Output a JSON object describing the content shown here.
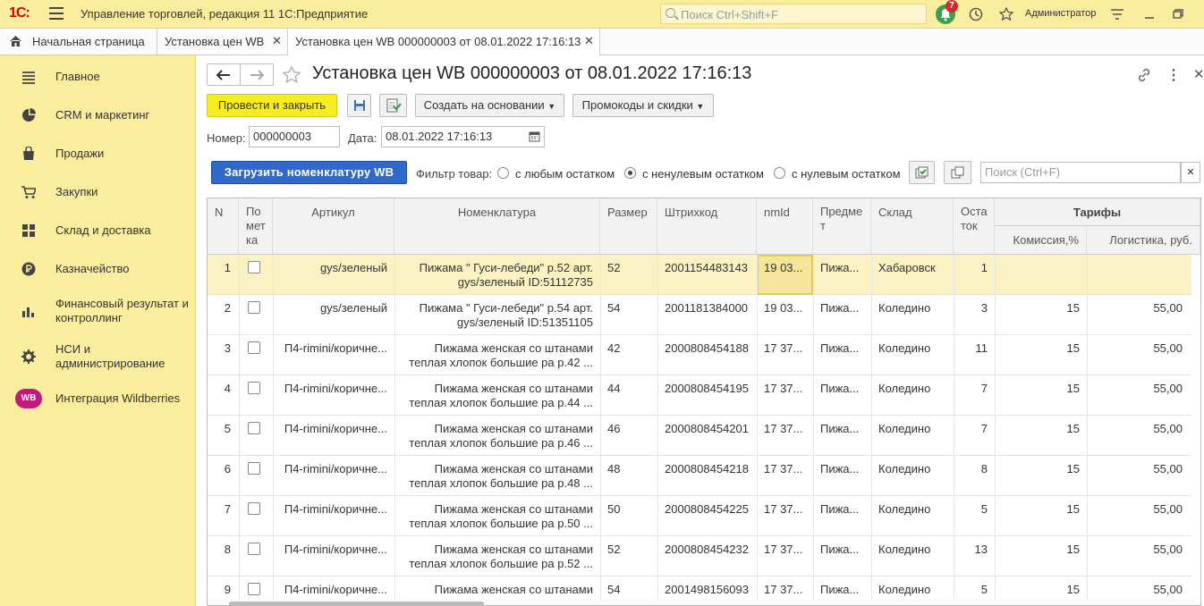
{
  "app": {
    "logo": "1С:",
    "title": "Управление торговлей, редакция 11 1С:Предприятие",
    "search_placeholder": "Поиск Ctrl+Shift+F",
    "notifications_count": "7",
    "user": "Администратор"
  },
  "tabs": [
    {
      "label": "Начальная страница"
    },
    {
      "label": "Установка цен WB"
    },
    {
      "label": "Установка цен WB 000000003 от 08.01.2022 17:16:13"
    }
  ],
  "sidebar": {
    "items": [
      {
        "label": "Главное",
        "icon": "menu-icon"
      },
      {
        "label": "CRM и маркетинг",
        "icon": "pie-chart-icon"
      },
      {
        "label": "Продажи",
        "icon": "bag-icon"
      },
      {
        "label": "Закупки",
        "icon": "cart-icon"
      },
      {
        "label": "Склад и доставка",
        "icon": "grid-icon"
      },
      {
        "label": "Казначейство",
        "icon": "ruble-icon"
      },
      {
        "label": "Финансовый результат и контроллинг",
        "icon": "bar-chart-icon"
      },
      {
        "label": "НСИ и администрирование",
        "icon": "gear-icon"
      },
      {
        "label": "Интеграция Wildberries",
        "icon": "wb-icon",
        "icon_text": "WB"
      }
    ]
  },
  "document": {
    "title": "Установка цен WB 000000003 от 08.01.2022 17:16:13",
    "post_close": "Провести и закрыть",
    "create_based": "Создать на основании",
    "promo": "Промокоды и скидки",
    "number_label": "Номер:",
    "number_value": "000000003",
    "date_label": "Дата:",
    "date_value": "08.01.2022 17:16:13",
    "load_button": "Загрузить  номенклатуру WB",
    "filter_label": "Фильтр товар:",
    "filter_any": "с любым остатком",
    "filter_nonzero": "с ненулевым остатком",
    "filter_zero": "с нулевым остатком",
    "filter_selected": "nonzero",
    "table_search_placeholder": "Поиск (Ctrl+F)"
  },
  "table": {
    "headers": {
      "n": "N",
      "mark": "По\nмет\nка",
      "article": "Артикул",
      "nomenclature": "Номенклатура",
      "size": "Размер",
      "barcode": "Штрихкод",
      "nmid": "nmId",
      "subject": "Предме\nт",
      "warehouse": "Склад",
      "stock": "Оста\nток",
      "tariffs": "Тарифы",
      "commission": "Комиссия,%",
      "logistics": "Логистика, руб."
    },
    "rows": [
      {
        "n": "1",
        "article": "gys/зеленый",
        "nom1": "Пижама \" Гуси-лебеди\" р.52 арт.",
        "nom2": "gys/зеленый ID:51112735",
        "size": "52",
        "barcode": "2001154483143",
        "nmid": "19 03...",
        "subject": "Пижа...",
        "warehouse": "Хабаровск",
        "stock": "1",
        "commission": "",
        "logistics": ""
      },
      {
        "n": "2",
        "article": "gys/зеленый",
        "nom1": "Пижама \" Гуси-лебеди\" р.54 арт.",
        "nom2": "gys/зеленый ID:51351105",
        "size": "54",
        "barcode": "2001181384000",
        "nmid": "19 03...",
        "subject": "Пижа...",
        "warehouse": "Коледино",
        "stock": "3",
        "commission": "15",
        "logistics": "55,00"
      },
      {
        "n": "3",
        "article": "П4-rimini/коричне...",
        "nom1": "Пижама женская со штанами",
        "nom2": "теплая хлопок большие ра р.42 ...",
        "size": "42",
        "barcode": "2000808454188",
        "nmid": "17 37...",
        "subject": "Пижа...",
        "warehouse": "Коледино",
        "stock": "11",
        "commission": "15",
        "logistics": "55,00"
      },
      {
        "n": "4",
        "article": "П4-rimini/коричне...",
        "nom1": "Пижама женская со штанами",
        "nom2": "теплая хлопок большие ра р.44 ...",
        "size": "44",
        "barcode": "2000808454195",
        "nmid": "17 37...",
        "subject": "Пижа...",
        "warehouse": "Коледино",
        "stock": "7",
        "commission": "15",
        "logistics": "55,00"
      },
      {
        "n": "5",
        "article": "П4-rimini/коричне...",
        "nom1": "Пижама женская со штанами",
        "nom2": "теплая хлопок большие ра р.46 ...",
        "size": "46",
        "barcode": "2000808454201",
        "nmid": "17 37...",
        "subject": "Пижа...",
        "warehouse": "Коледино",
        "stock": "7",
        "commission": "15",
        "logistics": "55,00"
      },
      {
        "n": "6",
        "article": "П4-rimini/коричне...",
        "nom1": "Пижама женская со штанами",
        "nom2": "теплая хлопок большие ра р.48 ...",
        "size": "48",
        "barcode": "2000808454218",
        "nmid": "17 37...",
        "subject": "Пижа...",
        "warehouse": "Коледино",
        "stock": "8",
        "commission": "15",
        "logistics": "55,00"
      },
      {
        "n": "7",
        "article": "П4-rimini/коричне...",
        "nom1": "Пижама женская со штанами",
        "nom2": "теплая хлопок большие ра р.50 ...",
        "size": "50",
        "barcode": "2000808454225",
        "nmid": "17 37...",
        "subject": "Пижа...",
        "warehouse": "Коледино",
        "stock": "5",
        "commission": "15",
        "logistics": "55,00"
      },
      {
        "n": "8",
        "article": "П4-rimini/коричне...",
        "nom1": "Пижама женская со штанами",
        "nom2": "теплая хлопок большие ра р.52 ...",
        "size": "52",
        "barcode": "2000808454232",
        "nmid": "17 37...",
        "subject": "Пижа...",
        "warehouse": "Коледино",
        "stock": "13",
        "commission": "15",
        "logistics": "55,00"
      },
      {
        "n": "9",
        "article": "П4-rimini/коричне...",
        "nom1": "Пижама женская со штанами",
        "nom2": "",
        "size": "54",
        "barcode": "2001498156093",
        "nmid": "17 37...",
        "subject": "Пижа...",
        "warehouse": "Коледино",
        "stock": "5",
        "commission": "15",
        "logistics": "55,00"
      }
    ]
  }
}
